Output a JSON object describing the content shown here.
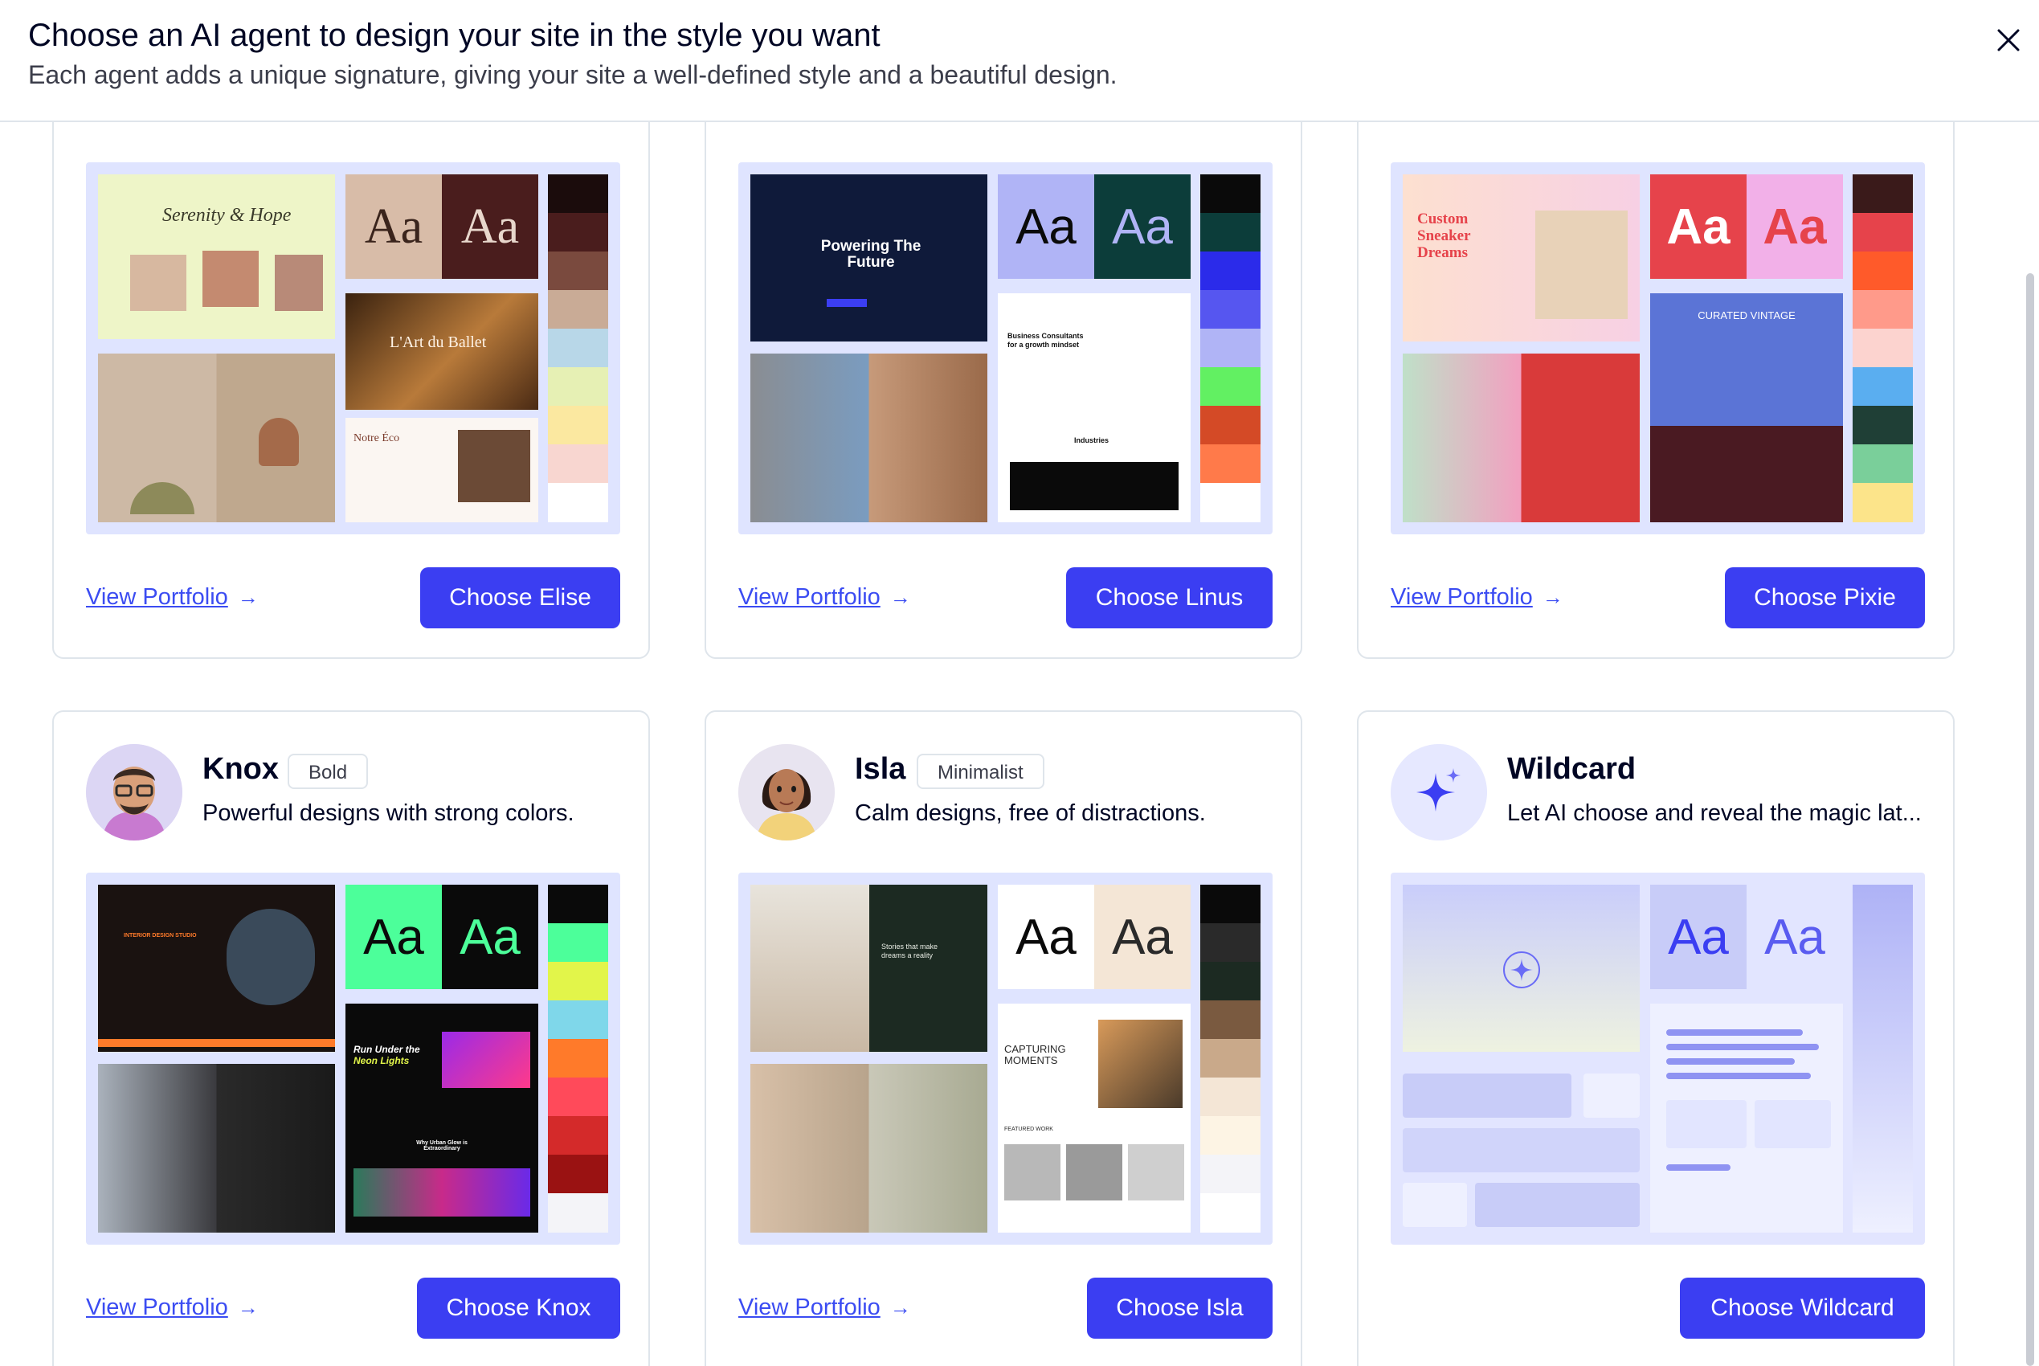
{
  "header": {
    "title": "Choose an AI agent to design your site in the style you want",
    "subtitle": "Each agent adds a unique signature, giving your site a well-defined style and a beautiful design."
  },
  "common": {
    "view_portfolio": "View Portfolio",
    "arrow": "→",
    "aa": "Aa"
  },
  "agents": [
    {
      "name": "Elise",
      "choose_label": "Choose Elise",
      "preview": {
        "text1": "Serenity & Hope",
        "text2": "L'Art du Ballet",
        "text3": "Notre Éco"
      },
      "palette": [
        "#1b0c0c",
        "#4a1d1d",
        "#7a4a3e",
        "#c9ab96",
        "#b8d7e8",
        "#e6f0b4",
        "#fbe8a0",
        "#f8d6d0",
        "#ffffff"
      ]
    },
    {
      "name": "Linus",
      "choose_label": "Choose Linus",
      "preview": {
        "text1": "Powering The Future",
        "text2": "Business Consultants for a growth mindset",
        "text3": "Industries"
      },
      "palette": [
        "#0a0a0a",
        "#0c3d3a",
        "#2b2bea",
        "#5656f0",
        "#b0b4f6",
        "#62f062",
        "#d44a26",
        "#ff7a4a",
        "#ffffff"
      ]
    },
    {
      "name": "Pixie",
      "choose_label": "Choose Pixie",
      "preview": {
        "text1": "Custom Sneaker Dreams",
        "text2": "CURATED VINTAGE"
      },
      "palette": [
        "#3a1a1a",
        "#e6434b",
        "#ff5a2a",
        "#ff9a8a",
        "#fcd3cf",
        "#5aaef0",
        "#1f3f36",
        "#7acf9a",
        "#fce48a"
      ]
    },
    {
      "name": "Knox",
      "tag": "Bold",
      "description": "Powerful designs with strong colors.",
      "choose_label": "Choose Knox",
      "preview": {
        "text1": "INTERIOR DESIGN STUDIO",
        "text2": "Run Under the",
        "text3": "Neon Lights",
        "text4": "Why Urban Glow is Extraordinary"
      },
      "palette": [
        "#0a0a0a",
        "#4cff9a",
        "#e2f54a",
        "#7fd7ea",
        "#ff7a2a",
        "#ff4a5a",
        "#d42a2a",
        "#9a1212",
        "#f4f4f8"
      ]
    },
    {
      "name": "Isla",
      "tag": "Minimalist",
      "description": "Calm designs, free of distractions.",
      "choose_label": "Choose Isla",
      "preview": {
        "text1": "Stories that make dreams a reality",
        "text2": "CAPTURING MOMENTS",
        "text3": "FEATURED WORK"
      },
      "palette": [
        "#0a0a0a",
        "#2a2a2a",
        "#1c2a22",
        "#7a5a40",
        "#c9a98a",
        "#f4e6d6",
        "#fdf4e4",
        "#f4f4f8",
        "#ffffff"
      ]
    },
    {
      "name": "Wildcard",
      "description": "Let AI choose and reveal the magic lat...",
      "choose_label": "Choose Wildcard"
    }
  ]
}
